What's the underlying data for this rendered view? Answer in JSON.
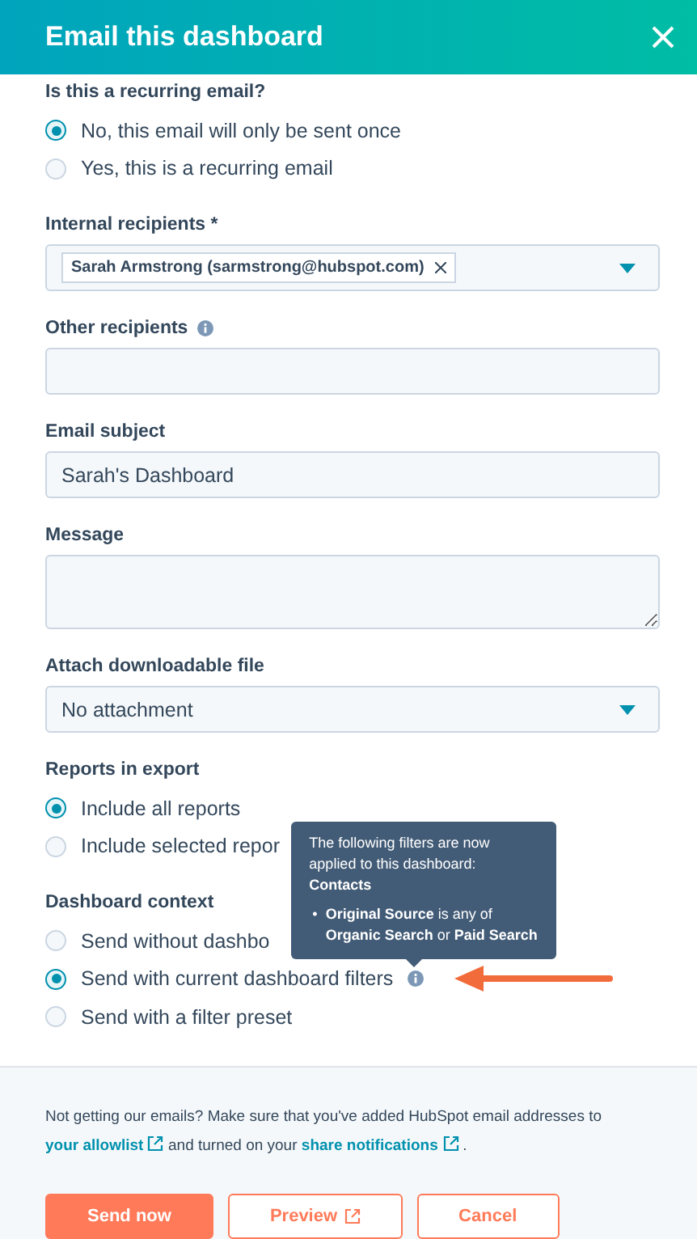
{
  "dialog": {
    "title": "Email this dashboard"
  },
  "sections": [
    {
      "kind": "radio_group",
      "label": "Is this a recurring email?",
      "options": [
        {
          "label": "No, this email will only be sent once",
          "selected": true
        },
        {
          "label": "Yes, this is a recurring email",
          "selected": false
        }
      ]
    },
    {
      "kind": "tag_select",
      "label": "Internal recipients *",
      "tags": [
        "Sarah Armstrong (sarmstrong@hubspot.com)"
      ]
    },
    {
      "kind": "input",
      "label": "Other recipients",
      "info": true
    },
    {
      "kind": "input",
      "label": "Email subject",
      "value": "Sarah's Dashboard"
    },
    {
      "kind": "textarea",
      "label": "Message"
    },
    {
      "kind": "select",
      "label": "Attach downloadable file",
      "value": "No attachment"
    },
    {
      "kind": "radio_group",
      "label": "Reports in export",
      "options": [
        {
          "label": "Include all reports",
          "selected": true
        },
        {
          "label": "Include selected repor",
          "selected": false
        }
      ]
    },
    {
      "kind": "radio_group",
      "label": "Dashboard context",
      "options": [
        {
          "label": "Send without dashbo",
          "selected": false
        },
        {
          "label": "Send with current dashboard filters",
          "selected": true,
          "info": true,
          "pointer_arrow": true
        },
        {
          "label": "Send with a filter preset",
          "selected": false
        }
      ]
    }
  ],
  "tooltip": {
    "intro": "The following filters are now applied to this dashboard:",
    "heading": "Contacts",
    "items": [
      {
        "bullet": "•",
        "text": "**Original Source** is any of **Organic Search** or **Paid Search**"
      }
    ]
  },
  "footer": {
    "notice": [
      {
        "kind": "text",
        "text": "Not getting our emails? Make sure that you've added HubSpot email addresses to"
      },
      {
        "kind": "link",
        "text": "your allowlist",
        "external": true
      },
      {
        "kind": "text",
        "text": "and turned on your"
      },
      {
        "kind": "link",
        "text": "share notifications",
        "external": true
      },
      {
        "kind": "text",
        "text": "."
      }
    ],
    "buttons": [
      {
        "label": "Send now",
        "kind": "primary"
      },
      {
        "label": "Preview",
        "kind": "secondary",
        "external": true
      },
      {
        "label": "Cancel",
        "kind": "secondary"
      }
    ]
  }
}
